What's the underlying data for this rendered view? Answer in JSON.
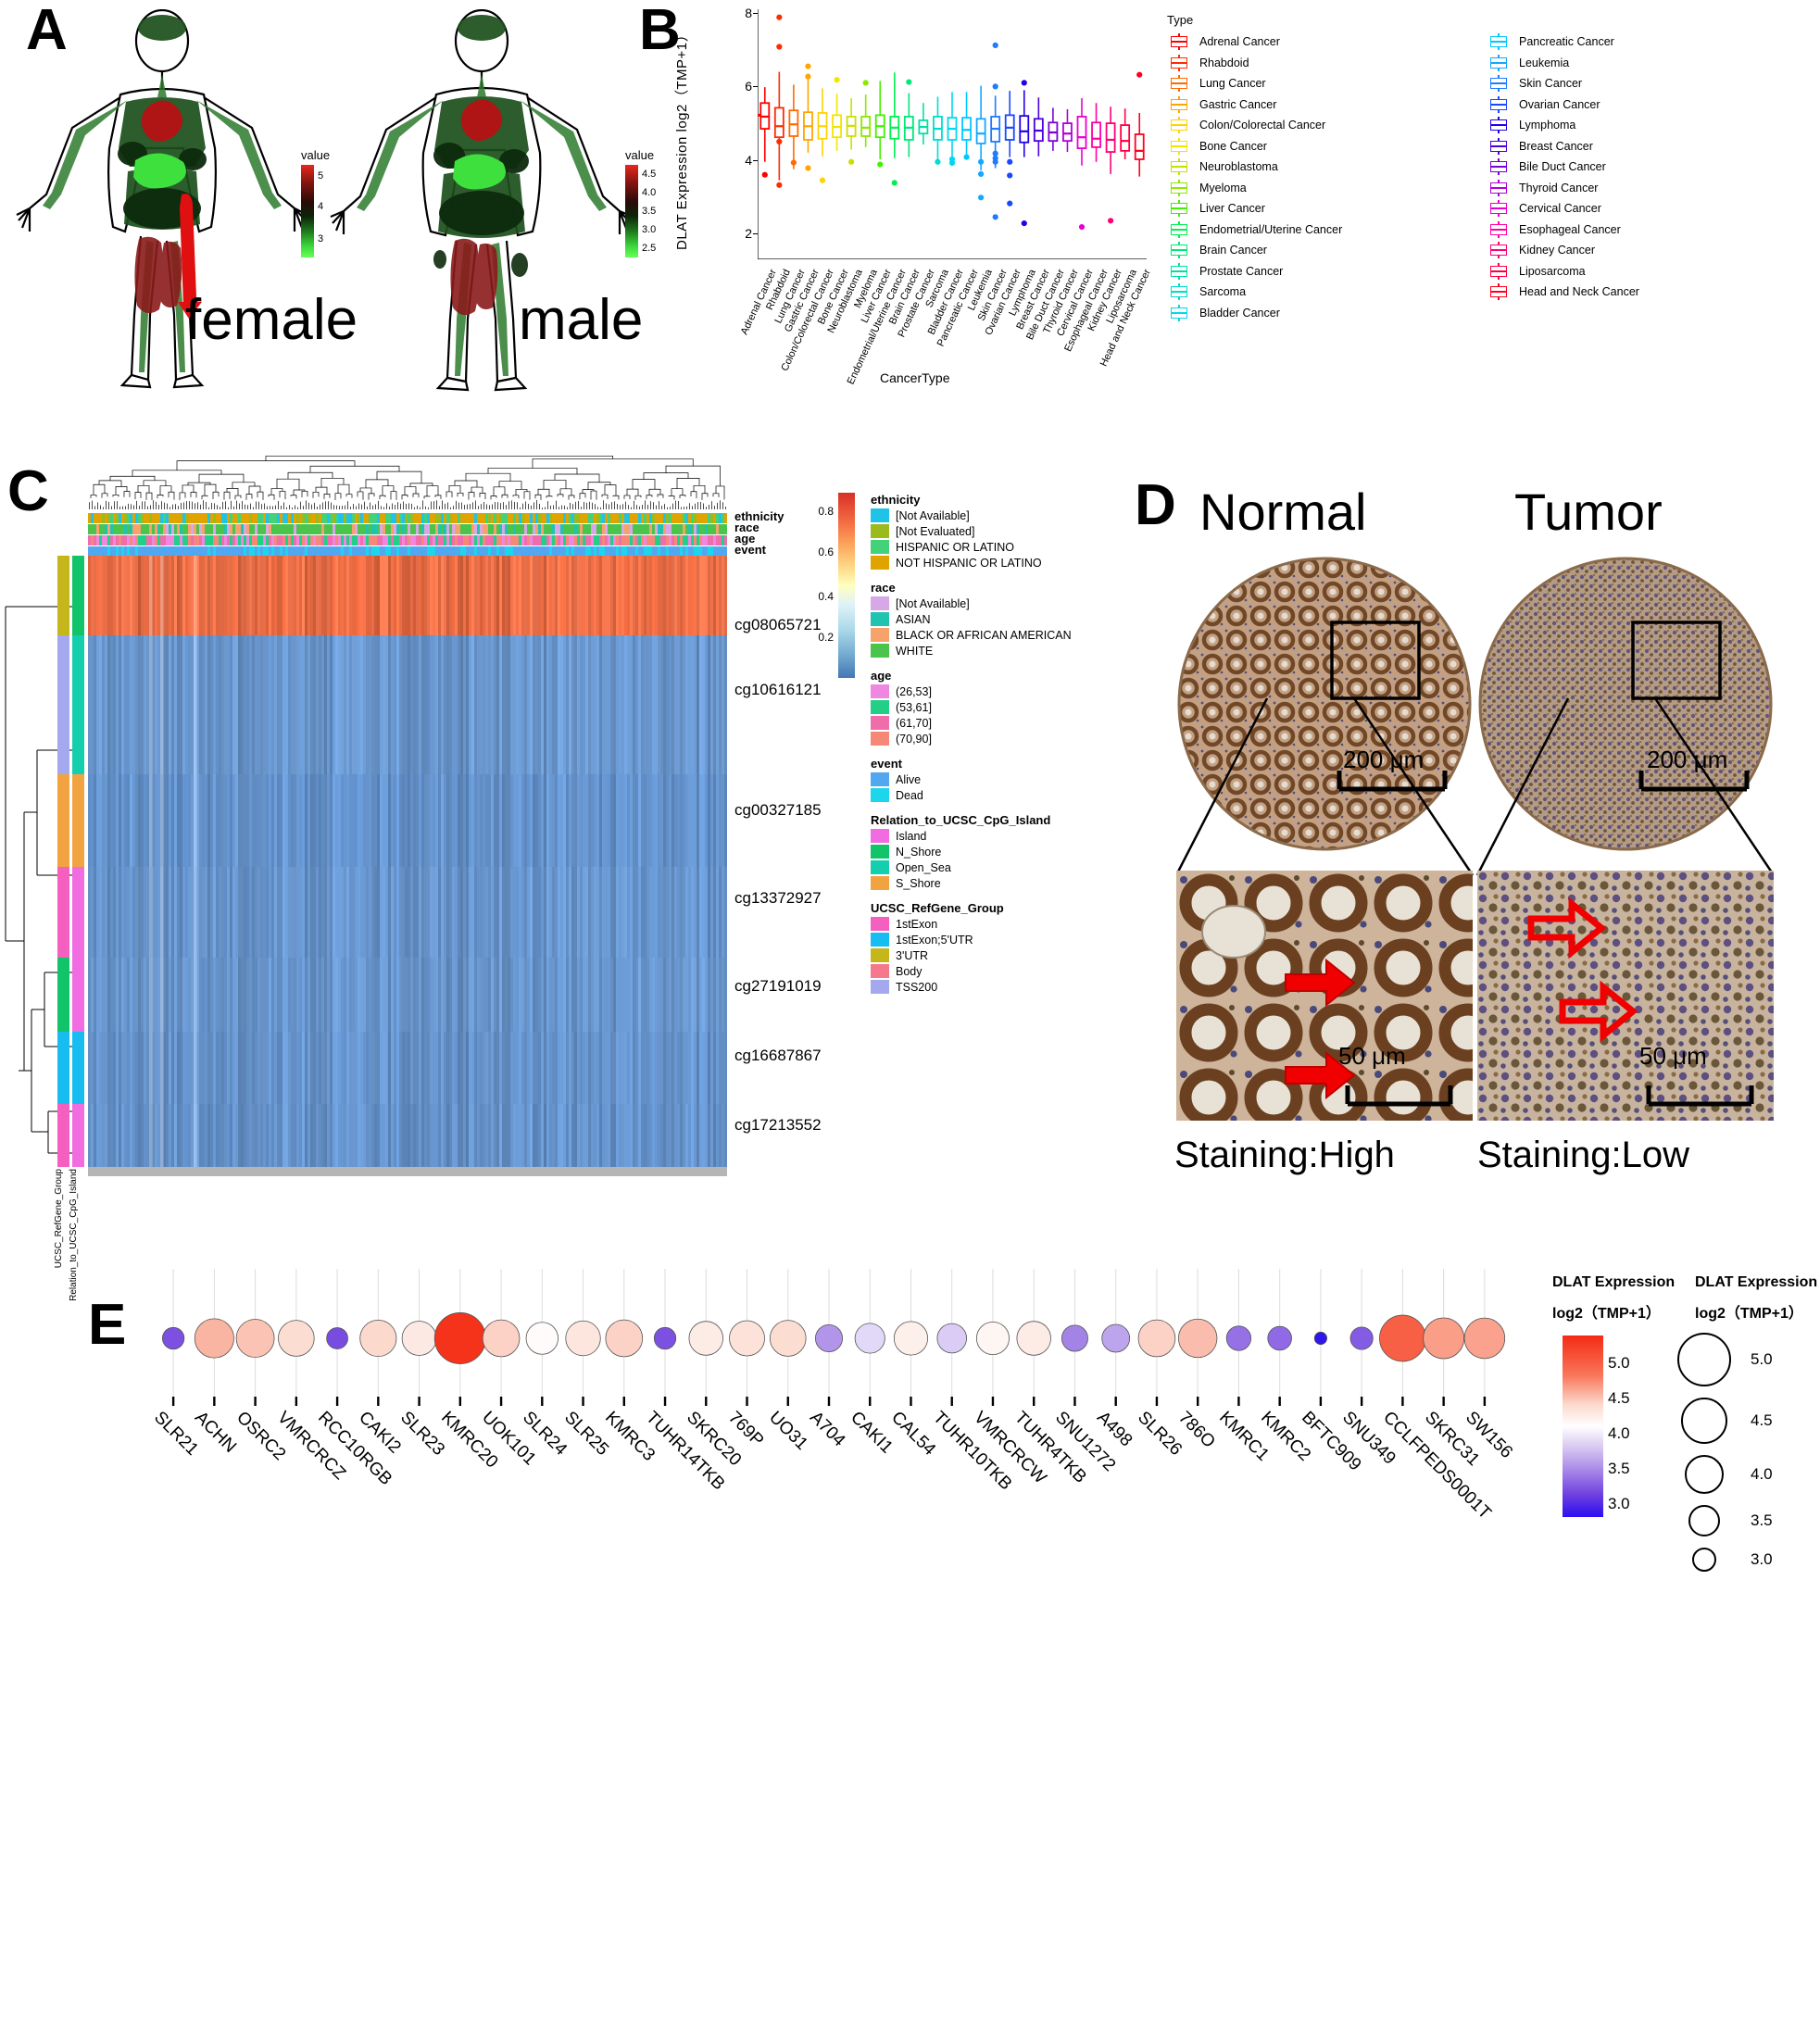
{
  "figure": {
    "panels": [
      "A",
      "B",
      "C",
      "D",
      "E"
    ]
  },
  "panelA": {
    "letter": "A",
    "female_label": "female",
    "male_label": "male",
    "legend_title": "value",
    "legend_female_ticks": [
      "5",
      "4",
      "3"
    ],
    "legend_male_ticks": [
      "4.5",
      "4.0",
      "3.5",
      "3.0",
      "2.5"
    ]
  },
  "panelB": {
    "letter": "B",
    "ylabel": "DLAT Expression  log2（TMP+1）",
    "xlabel": "CancerType",
    "legend_title": "Type",
    "yticks": [
      "2",
      "4",
      "6",
      "8"
    ],
    "chart_data": {
      "type": "box",
      "title": "",
      "xlabel": "CancerType",
      "ylabel": "DLAT Expression log2（TMP+1）",
      "ylim": [
        1.3,
        8.1
      ],
      "yticks": [
        2,
        4,
        6,
        8
      ],
      "categories": [
        "Adrenal Cancer",
        "Rhabdoid",
        "Lung Cancer",
        "Gastric Cancer",
        "Colon/Colorectal Cancer",
        "Bone Cancer",
        "Neuroblastoma",
        "Myeloma",
        "Liver Cancer",
        "Endometrial/Uterine Cancer",
        "Brain Cancer",
        "Prostate Cancer",
        "Sarcoma",
        "Bladder Cancer",
        "Pancreatic Cancer",
        "Leukemia",
        "Skin Cancer",
        "Ovarian Cancer",
        "Lymphoma",
        "Breast Cancer",
        "Bile Duct Cancer",
        "Thyroid Cancer",
        "Cervical Cancer",
        "Esophageal Cancer",
        "Kidney Cancer",
        "Liposarcoma",
        "Head and Neck Cancer"
      ],
      "colors": [
        "#ff0000",
        "#ff2b00",
        "#ff6a00",
        "#ffa500",
        "#ffd400",
        "#f2e500",
        "#c8e000",
        "#8ce800",
        "#44f000",
        "#00f050",
        "#00e87a",
        "#00e0a5",
        "#00ddd0",
        "#00d8f0",
        "#00c8ff",
        "#13a8ff",
        "#1f7bff",
        "#1b48ff",
        "#2400e8",
        "#4a00dd",
        "#7a00d8",
        "#b000d8",
        "#e800d0",
        "#ff00a5",
        "#ff0077",
        "#ff0044",
        "#ff0020"
      ],
      "boxes": [
        {
          "min": 3.95,
          "q1": 4.85,
          "med": 5.18,
          "q3": 5.55,
          "max": 5.98,
          "outliers": [
            3.6
          ]
        },
        {
          "min": 3.45,
          "q1": 4.62,
          "med": 4.92,
          "q3": 5.42,
          "max": 6.4,
          "outliers": [
            7.88,
            7.08,
            4.5,
            3.32
          ]
        },
        {
          "min": 3.75,
          "q1": 4.65,
          "med": 4.97,
          "q3": 5.35,
          "max": 6.05,
          "outliers": [
            3.93
          ]
        },
        {
          "min": 4.2,
          "q1": 4.55,
          "med": 4.92,
          "q3": 5.3,
          "max": 6.25,
          "outliers": [
            6.55,
            6.27,
            3.78
          ]
        },
        {
          "min": 4.1,
          "q1": 4.58,
          "med": 4.92,
          "q3": 5.28,
          "max": 5.95,
          "outliers": [
            3.45
          ]
        },
        {
          "min": 4.25,
          "q1": 4.62,
          "med": 4.9,
          "q3": 5.22,
          "max": 5.8,
          "outliers": [
            6.18
          ]
        },
        {
          "min": 4.28,
          "q1": 4.65,
          "med": 4.93,
          "q3": 5.18,
          "max": 5.68,
          "outliers": [
            3.95
          ]
        },
        {
          "min": 4.35,
          "q1": 4.65,
          "med": 4.88,
          "q3": 5.18,
          "max": 5.78,
          "outliers": [
            6.1
          ]
        },
        {
          "min": 4.02,
          "q1": 4.62,
          "med": 4.92,
          "q3": 5.22,
          "max": 6.15,
          "outliers": [
            3.88
          ]
        },
        {
          "min": 4.05,
          "q1": 4.58,
          "med": 4.88,
          "q3": 5.18,
          "max": 6.38,
          "outliers": [
            3.38
          ]
        },
        {
          "min": 4.08,
          "q1": 4.55,
          "med": 4.88,
          "q3": 5.18,
          "max": 5.82,
          "outliers": [
            6.12
          ]
        },
        {
          "min": 4.42,
          "q1": 4.72,
          "med": 4.9,
          "q3": 5.08,
          "max": 5.55,
          "outliers": []
        },
        {
          "min": 4.02,
          "q1": 4.55,
          "med": 4.85,
          "q3": 5.18,
          "max": 5.72,
          "outliers": [
            3.95
          ]
        },
        {
          "min": 4.05,
          "q1": 4.55,
          "med": 4.85,
          "q3": 5.15,
          "max": 5.85,
          "outliers": [
            4.02,
            3.92
          ]
        },
        {
          "min": 4.02,
          "q1": 4.55,
          "med": 4.82,
          "q3": 5.15,
          "max": 5.85,
          "outliers": [
            4.08
          ]
        },
        {
          "min": 3.72,
          "q1": 4.45,
          "med": 4.72,
          "q3": 5.12,
          "max": 6.02,
          "outliers": [
            3.95,
            3.62,
            2.98
          ]
        },
        {
          "min": 3.78,
          "q1": 4.5,
          "med": 4.85,
          "q3": 5.18,
          "max": 5.75,
          "outliers": [
            7.12,
            6.0,
            4.18,
            4.05,
            3.95,
            2.45
          ]
        },
        {
          "min": 4.08,
          "q1": 4.55,
          "med": 4.88,
          "q3": 5.22,
          "max": 5.88,
          "outliers": [
            3.95,
            3.58,
            2.82
          ]
        },
        {
          "min": 4.08,
          "q1": 4.48,
          "med": 4.78,
          "q3": 5.2,
          "max": 5.9,
          "outliers": [
            6.1,
            2.28
          ]
        },
        {
          "min": 4.1,
          "q1": 4.52,
          "med": 4.8,
          "q3": 5.12,
          "max": 5.7,
          "outliers": []
        },
        {
          "min": 4.25,
          "q1": 4.52,
          "med": 4.75,
          "q3": 5.02,
          "max": 5.42,
          "outliers": []
        },
        {
          "min": 4.22,
          "q1": 4.52,
          "med": 4.72,
          "q3": 5.0,
          "max": 5.38,
          "outliers": []
        },
        {
          "min": 3.85,
          "q1": 4.32,
          "med": 4.62,
          "q3": 5.18,
          "max": 5.68,
          "outliers": [
            2.18
          ]
        },
        {
          "min": 3.95,
          "q1": 4.35,
          "med": 4.58,
          "q3": 5.02,
          "max": 5.55,
          "outliers": []
        },
        {
          "min": 3.62,
          "q1": 4.22,
          "med": 4.55,
          "q3": 5.0,
          "max": 5.45,
          "outliers": [
            2.35
          ]
        },
        {
          "min": 4.02,
          "q1": 4.25,
          "med": 4.52,
          "q3": 4.95,
          "max": 5.4,
          "outliers": []
        },
        {
          "min": 3.55,
          "q1": 4.02,
          "med": 4.25,
          "q3": 4.7,
          "max": 5.28,
          "outliers": [
            6.32
          ]
        }
      ],
      "reference_line": 5.22
    }
  },
  "panelC": {
    "letter": "C",
    "anno_rows": [
      "ethnicity",
      "race",
      "age",
      "event"
    ],
    "probes": [
      "cg08065721",
      "cg10616121",
      "cg00327185",
      "cg13372927",
      "cg27191019",
      "cg16687867",
      "cg17213552"
    ],
    "side_captions": [
      "UCSC_RefGene_Group",
      "Relation_to_UCSC_CpG_Island"
    ],
    "colorbar_ticks": [
      "0.8",
      "0.6",
      "0.4",
      "0.2"
    ],
    "legend_groups": [
      {
        "title": "ethnicity",
        "items": [
          {
            "label": "[Not Available]",
            "color": "#1fc3e8"
          },
          {
            "label": "[Not Evaluated]",
            "color": "#9aba1e"
          },
          {
            "label": "HISPANIC OR LATINO",
            "color": "#43d17a"
          },
          {
            "label": "NOT HISPANIC OR LATINO",
            "color": "#e0a400"
          }
        ]
      },
      {
        "title": "race",
        "items": [
          {
            "label": "[Not Available]",
            "color": "#d7a8e8"
          },
          {
            "label": "ASIAN",
            "color": "#1fc3b0"
          },
          {
            "label": "BLACK OR AFRICAN AMERICAN",
            "color": "#f5a26b"
          },
          {
            "label": "WHITE",
            "color": "#4ac44a"
          }
        ]
      },
      {
        "title": "age",
        "items": [
          {
            "label": "(26,53]",
            "color": "#ef86e0"
          },
          {
            "label": "(53,61]",
            "color": "#21cf87"
          },
          {
            "label": "(61,70]",
            "color": "#f06dab"
          },
          {
            "label": "(70,90]",
            "color": "#f58877"
          }
        ]
      },
      {
        "title": "event",
        "items": [
          {
            "label": "Alive",
            "color": "#52a8f0"
          },
          {
            "label": "Dead",
            "color": "#1ed6ec"
          }
        ]
      },
      {
        "title": "Relation_to_UCSC_CpG_Island",
        "items": [
          {
            "label": "Island",
            "color": "#f06ce0"
          },
          {
            "label": "N_Shore",
            "color": "#11c46a"
          },
          {
            "label": "Open_Sea",
            "color": "#14cfae"
          },
          {
            "label": "S_Shore",
            "color": "#f2a341"
          }
        ]
      },
      {
        "title": "UCSC_RefGene_Group",
        "items": [
          {
            "label": "1stExon",
            "color": "#f45fc0"
          },
          {
            "label": "1stExon;5'UTR",
            "color": "#17bdf0"
          },
          {
            "label": "3'UTR",
            "color": "#c5b61b"
          },
          {
            "label": "Body",
            "color": "#f4798d"
          },
          {
            "label": "TSS200",
            "color": "#a4a8ee"
          }
        ]
      }
    ]
  },
  "panelD": {
    "letter": "D",
    "normal_title": "Normal",
    "tumor_title": "Tumor",
    "scalebar_core": "200 μm",
    "scalebar_zoom": "50 μm",
    "staining_normal": "Staining:High",
    "staining_tumor": "Staining:Low"
  },
  "panelE": {
    "letter": "E",
    "color_legend_title_line1": "DLAT Expression",
    "color_legend_title_line2": "log2（TMP+1）",
    "size_legend_title_line1": "DLAT Expression",
    "size_legend_title_line2": "log2（TMP+1）",
    "colorbar_ticks": [
      "5.0",
      "4.5",
      "4.0",
      "3.5",
      "3.0"
    ],
    "size_ticks": [
      "5.0",
      "4.5",
      "4.0",
      "3.5",
      "3.0"
    ],
    "chart_data": {
      "type": "scatter",
      "title": "",
      "xlabel": "",
      "ylabel": "DLAT Expression log2（TMP+1）",
      "categories": [
        "SLR21",
        "ACHN",
        "OSRC2",
        "VMRCRCZ",
        "RCC10RGB",
        "CAKI2",
        "SLR23",
        "KMRC20",
        "UOK101",
        "SLR24",
        "SLR25",
        "KMRC3",
        "TUHR14TKB",
        "SKRC20",
        "769P",
        "UO31",
        "A704",
        "CAKI1",
        "CAL54",
        "TUHR10TKB",
        "VMRCRCW",
        "TUHR4TKB",
        "SNU1272",
        "A498",
        "SLR26",
        "786O",
        "KMRC1",
        "KMRC2",
        "BFTC909",
        "SNU349",
        "CCLFPEDS0001T",
        "SKRC31",
        "SW156"
      ],
      "values": [
        3.55,
        4.62,
        4.55,
        4.42,
        3.52,
        4.45,
        4.32,
        5.35,
        4.48,
        4.18,
        4.35,
        4.48,
        3.55,
        4.3,
        4.38,
        4.42,
        3.88,
        4.05,
        4.28,
        4.02,
        4.22,
        4.3,
        3.82,
        3.92,
        4.48,
        4.58,
        3.72,
        3.68,
        2.98,
        3.6,
        5.05,
        4.72,
        4.7
      ]
    }
  }
}
